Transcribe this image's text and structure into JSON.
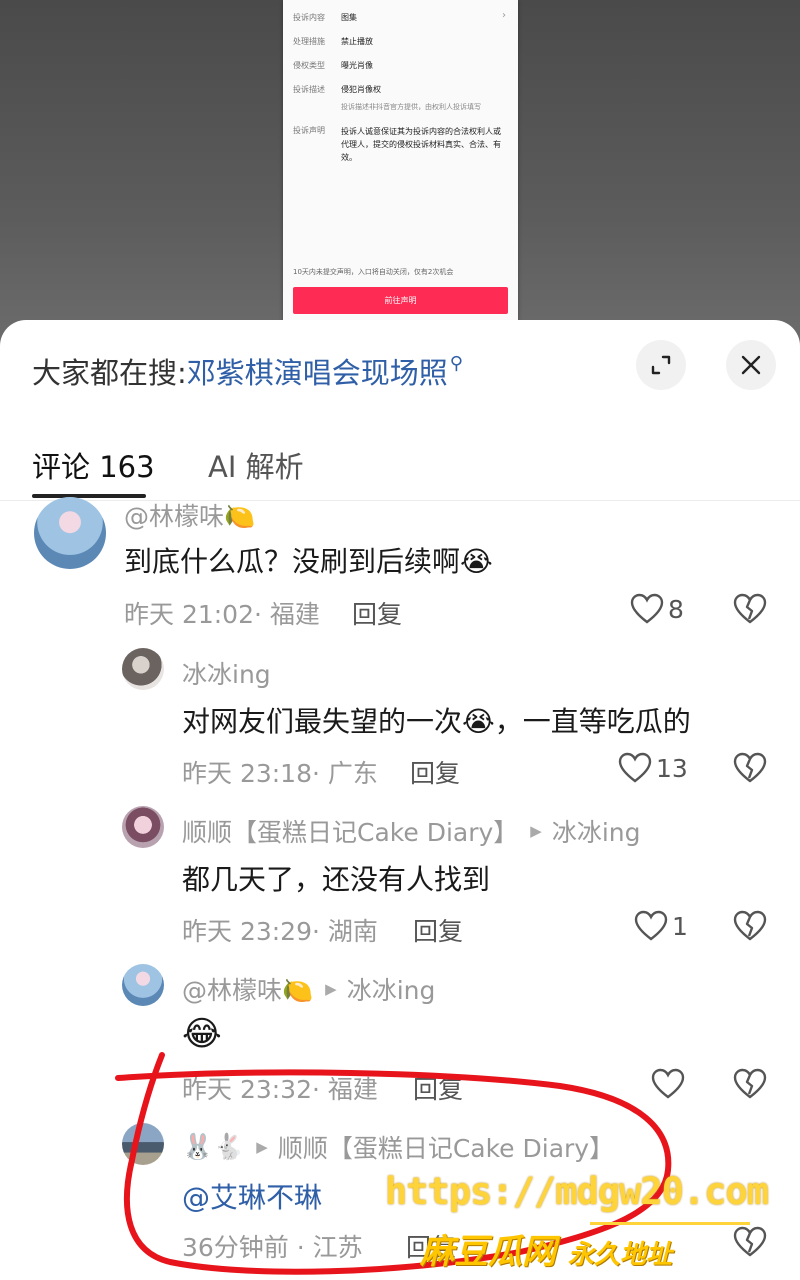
{
  "preview": {
    "rows": [
      {
        "key": "投诉内容",
        "value": "图集"
      },
      {
        "key": "处理措施",
        "value": "禁止播放"
      },
      {
        "key": "侵权类型",
        "value": "曝光肖像"
      },
      {
        "key": "投诉描述",
        "value": "侵犯肖像权"
      }
    ],
    "note": "投诉描述非抖音官方提供，由权利人投诉填写",
    "declaration_key": "投诉声明",
    "declaration_value": "投诉人诚意保证其为投诉内容的合法权利人或代理人，提交的侵权投诉材料真实、合法、有效。",
    "footer": "10天内未提交声明，入口将自动关闭，仅有2次机会",
    "button": "前往声明"
  },
  "header": {
    "search_prefix": "大家都在搜:",
    "search_term": "邓紫棋演唱会现场照"
  },
  "tabs": {
    "comments": "评论 163",
    "ai": "AI 解析"
  },
  "comments": [
    {
      "user": "@林檬味🍋",
      "text": "到底什么瓜？没刷到后续啊😭",
      "meta": "昨天 21:02· 福建",
      "reply": "回复",
      "likes": "8"
    },
    {
      "user": "冰冰ing",
      "text": "对网友们最失望的一次😭，一直等吃瓜的",
      "meta": "昨天 23:18· 广东",
      "reply": "回复",
      "likes": "13"
    },
    {
      "user": "顺顺【蛋糕日记Cake Diary】",
      "reply_to": "冰冰ing",
      "text": "都几天了，还没有人找到",
      "meta": "昨天 23:29· 湖南",
      "reply": "回复",
      "likes": "1"
    },
    {
      "user": "@林檬味🍋",
      "reply_to": "冰冰ing",
      "text": "😂",
      "meta": "昨天 23:32· 福建",
      "reply": "回复",
      "likes": ""
    },
    {
      "user": "🐰🐇",
      "reply_to": "顺顺【蛋糕日记Cake Diary】",
      "text": "@艾琳不琳",
      "meta": "36分钟前 · 江苏",
      "reply": "回复",
      "likes": ""
    }
  ],
  "watermark": {
    "url": "https://mdgw20.com",
    "name": "麻豆瓜网",
    "sub": "永久地址"
  },
  "colors": {
    "accent_red": "#fe2c55",
    "link_blue": "#2f5fa6",
    "annotation_red": "#e8141c",
    "watermark_yellow": "#ffd43a"
  }
}
